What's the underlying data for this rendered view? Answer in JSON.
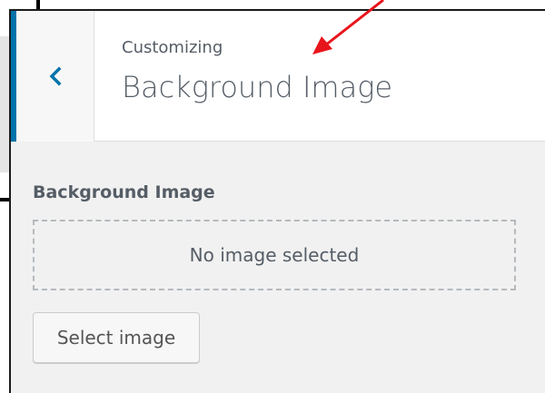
{
  "header": {
    "breadcrumb": "Customizing",
    "title": "Background Image",
    "back_icon": "chevron-left-icon"
  },
  "control": {
    "label": "Background Image",
    "placeholder": "No image selected",
    "select_button_label": "Select image"
  },
  "colors": {
    "accent": "#0073aa",
    "annotation_arrow": "#e8141b",
    "panel_background": "#f1f1f1",
    "text": "#555d66"
  },
  "annotation": {
    "icon": "red-arrow-icon"
  }
}
